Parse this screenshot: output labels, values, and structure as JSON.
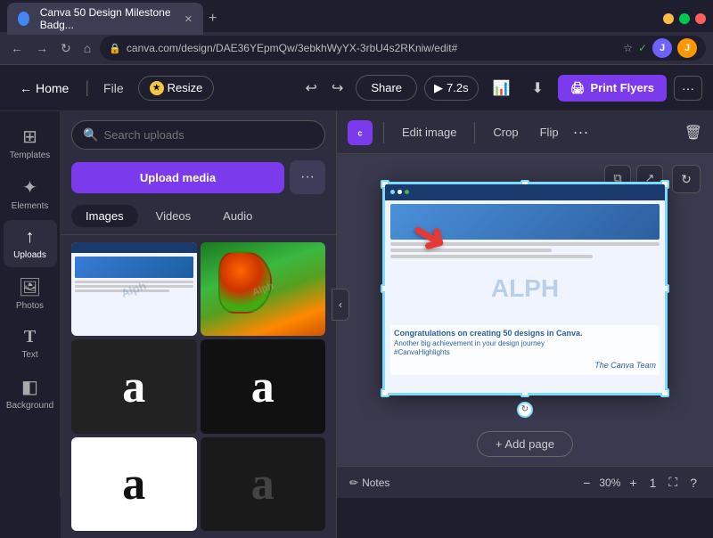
{
  "browser": {
    "tab_title": "Canva 50 Design Milestone Badg...",
    "url": "canva.com/design/DAE36YEpmQw/3ebkhWyYX-3rbU4s2RKniw/edit#",
    "favicon": "C",
    "profile_initials": "J"
  },
  "header": {
    "home_label": "Home",
    "file_label": "File",
    "resize_label": "Resize",
    "share_label": "Share",
    "play_duration": "7.2s",
    "print_label": "Print Flyers",
    "more_label": "···"
  },
  "sidebar": {
    "items": [
      {
        "id": "templates",
        "label": "Templates",
        "icon": "⊞"
      },
      {
        "id": "elements",
        "label": "Elements",
        "icon": "✦"
      },
      {
        "id": "uploads",
        "label": "Uploads",
        "icon": "↑"
      },
      {
        "id": "photos",
        "label": "Photos",
        "icon": "🖼"
      },
      {
        "id": "text",
        "label": "Text",
        "icon": "T"
      },
      {
        "id": "background",
        "label": "Background",
        "icon": "◧"
      }
    ]
  },
  "panel": {
    "search_placeholder": "Search uploads",
    "upload_label": "Upload media",
    "upload_more": "···",
    "tabs": [
      "Images",
      "Videos",
      "Audio"
    ],
    "active_tab": "Images"
  },
  "canvas_toolbar": {
    "edit_label": "Edit image",
    "crop_label": "Crop",
    "flip_label": "Flip",
    "more": "···"
  },
  "canvas": {
    "add_page_label": "+ Add page",
    "rotate_icon": "↻",
    "copy_icon": "⧉",
    "share_icon": "↗"
  },
  "bottom_bar": {
    "notes_label": "Notes",
    "zoom_level": "30%",
    "page_num": "1"
  },
  "watermark": "Alph",
  "card_text": {
    "alph_watermark": "ALPH",
    "congrats_line1": "Congratulations on creating 50 designs in Canva.",
    "congrats_line2": "Another big achievement in your design journey",
    "hashtag": "#CanvaHighlights",
    "signature": "The Canva Team"
  }
}
